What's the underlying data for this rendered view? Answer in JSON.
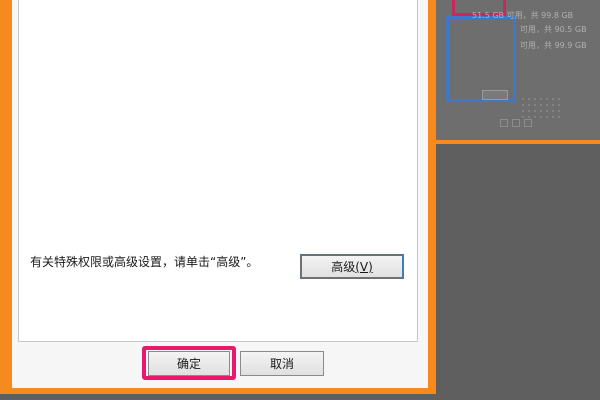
{
  "dialog": {
    "info_text": "有关特殊权限或高级设置，请单击“高级”。",
    "advanced_label": "高级",
    "advanced_accel": "(V)",
    "ok_label": "确定",
    "cancel_label": "取消"
  },
  "background_window": {
    "line1": "51.5 GB 可用，共 99.8 GB",
    "line2": "可用，共 90.5 GB",
    "line3": "可用，共 99.9 GB"
  },
  "colors": {
    "frame_orange": "#f58a1f",
    "highlight_pink": "#e8196b",
    "focus_blue": "#3c7fb1",
    "bg_blue_box": "#3e79c9"
  }
}
